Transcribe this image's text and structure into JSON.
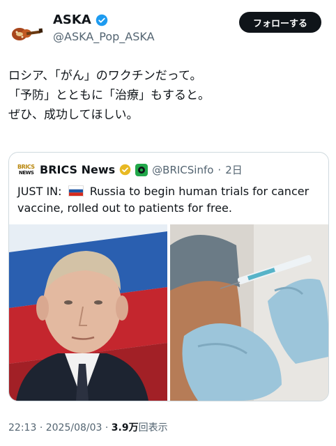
{
  "tweet": {
    "display_name": "ASKA",
    "handle": "@ASKA_Pop_ASKA",
    "follow_label": "フォローする",
    "text": "ロシア、「がん」のワクチンだって。\n「予防」とともに「治療」もすると。\nぜひ、成功してほしい。",
    "time": "22:13",
    "date": "2025/08/03",
    "views_count": "3.9万",
    "views_label": "回表示"
  },
  "quote": {
    "logo_text_top": "BRICS",
    "logo_text_bottom": "NEWS",
    "display_name": "BRICS News",
    "handle": "@BRICSinfo",
    "time_ago": "2日",
    "text_before_flag": "JUST IN:",
    "text_after_flag": "Russia to begin human trials for cancer vaccine, rolled out to patients for free."
  },
  "colors": {
    "verified_blue": "#1d9bf0",
    "gold_badge": "#e8b923",
    "follow_bg": "#0f1419"
  },
  "icons": {
    "verified": "verified-check-icon",
    "gold_badge": "gold-verified-icon",
    "affiliate": "affiliate-badge-icon",
    "flag": "russia-flag-icon"
  }
}
